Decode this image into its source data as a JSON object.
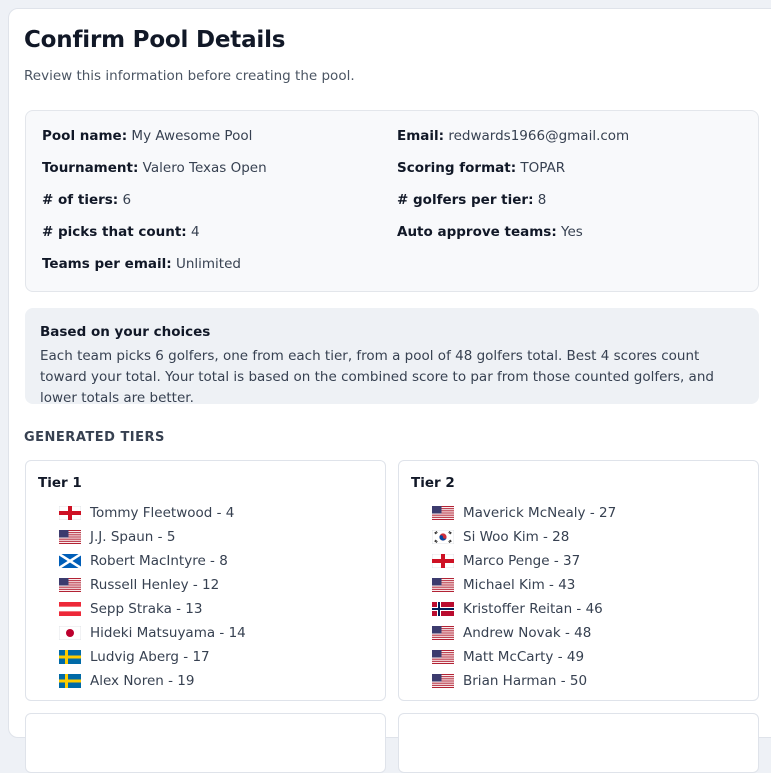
{
  "page": {
    "title": "Confirm Pool Details",
    "subtitle": "Review this information before creating the pool."
  },
  "details": {
    "pool_name": {
      "label": "Pool name:",
      "value": "My Awesome Pool"
    },
    "email": {
      "label": "Email:",
      "value": "redwards1966@gmail.com"
    },
    "tournament": {
      "label": "Tournament:",
      "value": "Valero Texas Open"
    },
    "scoring": {
      "label": "Scoring format:",
      "value": "TOPAR"
    },
    "tiers": {
      "label": "# of tiers:",
      "value": "6"
    },
    "golfers_per_tier": {
      "label": "# golfers per tier:",
      "value": "8"
    },
    "picks_count": {
      "label": "# picks that count:",
      "value": "4"
    },
    "auto_approve": {
      "label": "Auto approve teams:",
      "value": "Yes"
    },
    "teams_per_email": {
      "label": "Teams per email:",
      "value": "Unlimited"
    }
  },
  "summary": {
    "title": "Based on your choices",
    "text": "Each team picks 6 golfers, one from each tier, from a pool of 48 golfers total. Best 4 scores count toward your total. Your total is based on the combined score to par from those counted golfers, and lower totals are better."
  },
  "section_heading": "GENERATED TIERS",
  "colors": {
    "card_bg": "#ffffff",
    "page_bg": "#eef1f6",
    "summary_bg": "#eef1f5",
    "text": "#374151"
  },
  "tiers": [
    {
      "name": "Tier 1",
      "golfers": [
        {
          "label": "Tommy Fleetwood - 4",
          "flag": "england-flag-icon"
        },
        {
          "label": "J.J. Spaun - 5",
          "flag": "usa-flag-icon"
        },
        {
          "label": "Robert MacIntyre - 8",
          "flag": "scotland-flag-icon"
        },
        {
          "label": "Russell Henley - 12",
          "flag": "usa-flag-icon"
        },
        {
          "label": "Sepp Straka - 13",
          "flag": "austria-flag-icon"
        },
        {
          "label": "Hideki Matsuyama - 14",
          "flag": "japan-flag-icon"
        },
        {
          "label": "Ludvig Aberg - 17",
          "flag": "sweden-flag-icon"
        },
        {
          "label": "Alex Noren - 19",
          "flag": "sweden-flag-icon"
        }
      ]
    },
    {
      "name": "Tier 2",
      "golfers": [
        {
          "label": "Maverick McNealy - 27",
          "flag": "usa-flag-icon"
        },
        {
          "label": "Si Woo Kim - 28",
          "flag": "korea-flag-icon"
        },
        {
          "label": "Marco Penge - 37",
          "flag": "england-flag-icon"
        },
        {
          "label": "Michael Kim - 43",
          "flag": "usa-flag-icon"
        },
        {
          "label": "Kristoffer Reitan - 46",
          "flag": "norway-flag-icon"
        },
        {
          "label": "Andrew Novak - 48",
          "flag": "usa-flag-icon"
        },
        {
          "label": "Matt McCarty - 49",
          "flag": "usa-flag-icon"
        },
        {
          "label": "Brian Harman - 50",
          "flag": "usa-flag-icon"
        }
      ]
    }
  ]
}
